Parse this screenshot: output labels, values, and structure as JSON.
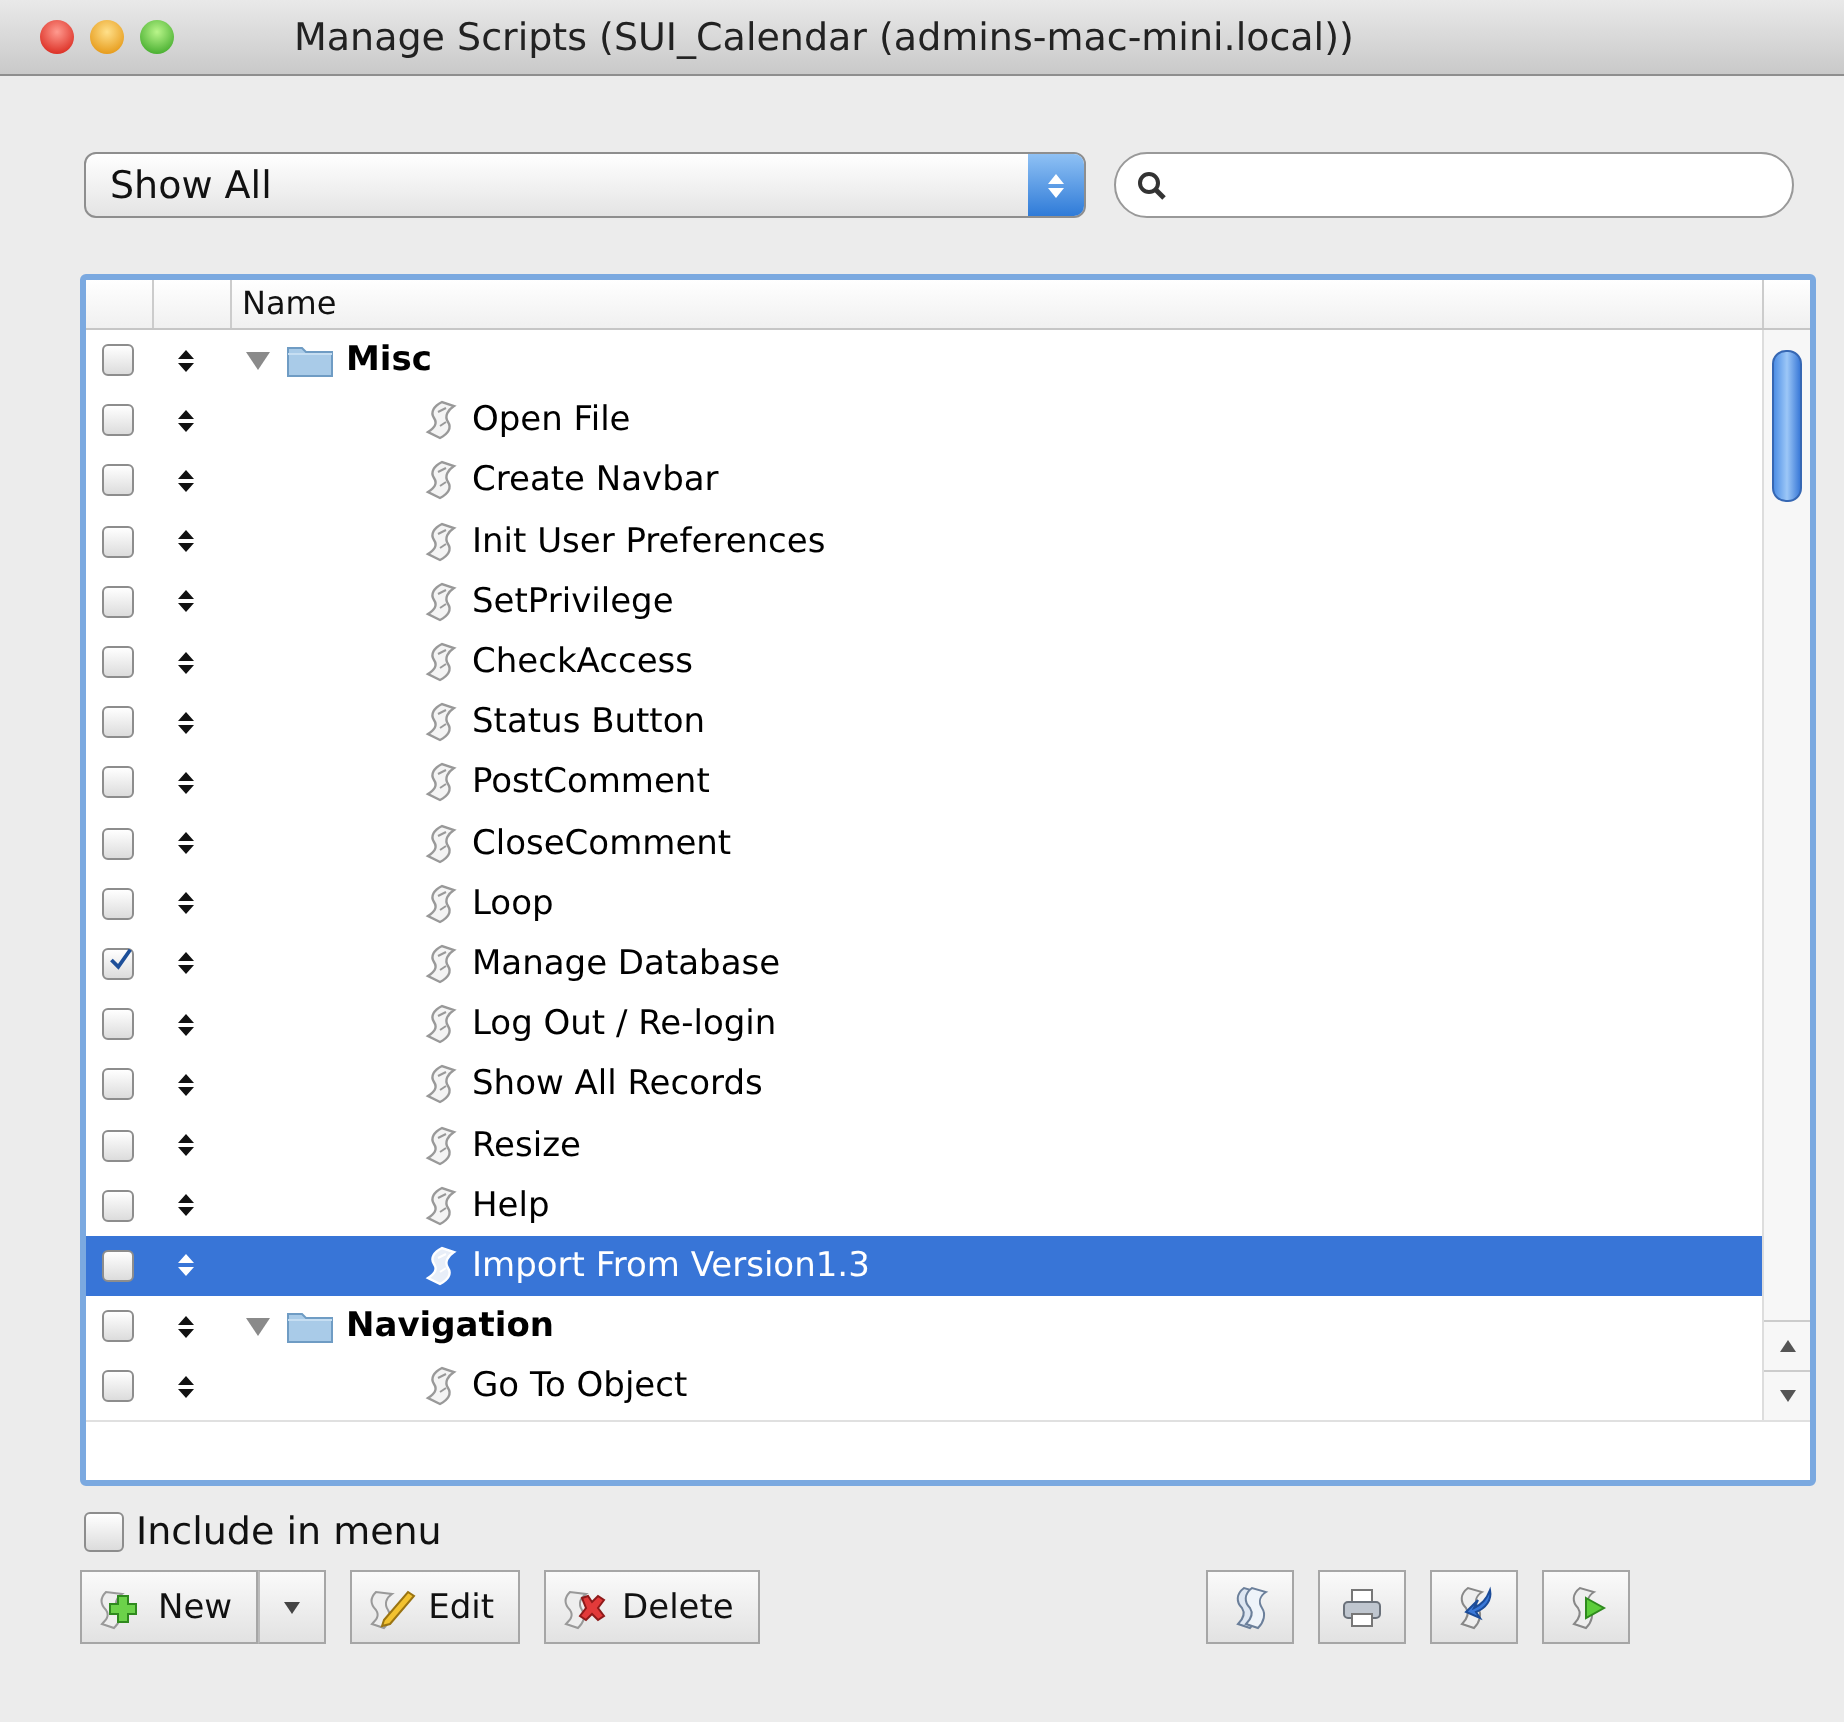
{
  "window": {
    "title": "Manage Scripts (SUI_Calendar (admins-mac-mini.local))"
  },
  "filter": {
    "value": "Show All"
  },
  "table": {
    "columns": [
      "Name"
    ],
    "tree": [
      {
        "name": "Misc",
        "kind": "folder",
        "expanded": true,
        "checked": false,
        "selected": false,
        "children": [
          {
            "name": "Open File",
            "kind": "script",
            "checked": false,
            "selected": false
          },
          {
            "name": "Create Navbar",
            "kind": "script",
            "checked": false,
            "selected": false
          },
          {
            "name": "Init User Preferences",
            "kind": "script",
            "checked": false,
            "selected": false
          },
          {
            "name": "SetPrivilege",
            "kind": "script",
            "checked": false,
            "selected": false
          },
          {
            "name": "CheckAccess",
            "kind": "script",
            "checked": false,
            "selected": false
          },
          {
            "name": "Status Button",
            "kind": "script",
            "checked": false,
            "selected": false
          },
          {
            "name": "PostComment",
            "kind": "script",
            "checked": false,
            "selected": false
          },
          {
            "name": "CloseComment",
            "kind": "script",
            "checked": false,
            "selected": false
          },
          {
            "name": "Loop",
            "kind": "script",
            "checked": false,
            "selected": false
          },
          {
            "name": "Manage Database",
            "kind": "script",
            "checked": true,
            "selected": false
          },
          {
            "name": "Log Out / Re-login",
            "kind": "script",
            "checked": false,
            "selected": false
          },
          {
            "name": "Show All Records",
            "kind": "script",
            "checked": false,
            "selected": false
          },
          {
            "name": "Resize",
            "kind": "script",
            "checked": false,
            "selected": false
          },
          {
            "name": "Help",
            "kind": "script",
            "checked": false,
            "selected": false
          },
          {
            "name": "Import From Version1.3",
            "kind": "script",
            "checked": false,
            "selected": true
          }
        ]
      },
      {
        "name": "Navigation",
        "kind": "folder",
        "expanded": true,
        "checked": false,
        "selected": false,
        "children": [
          {
            "name": "Go To Object",
            "kind": "script",
            "checked": false,
            "selected": false
          }
        ]
      }
    ]
  },
  "include_in_menu": {
    "label": "Include in menu",
    "checked": false
  },
  "buttons": [
    {
      "label": "New",
      "kind": "new"
    },
    {
      "label": "Edit",
      "kind": "edit"
    },
    {
      "label": "Delete",
      "kind": "delete"
    }
  ],
  "tool_buttons": [
    {
      "kind": "scripts"
    },
    {
      "kind": "print"
    },
    {
      "kind": "import"
    },
    {
      "kind": "run"
    }
  ]
}
